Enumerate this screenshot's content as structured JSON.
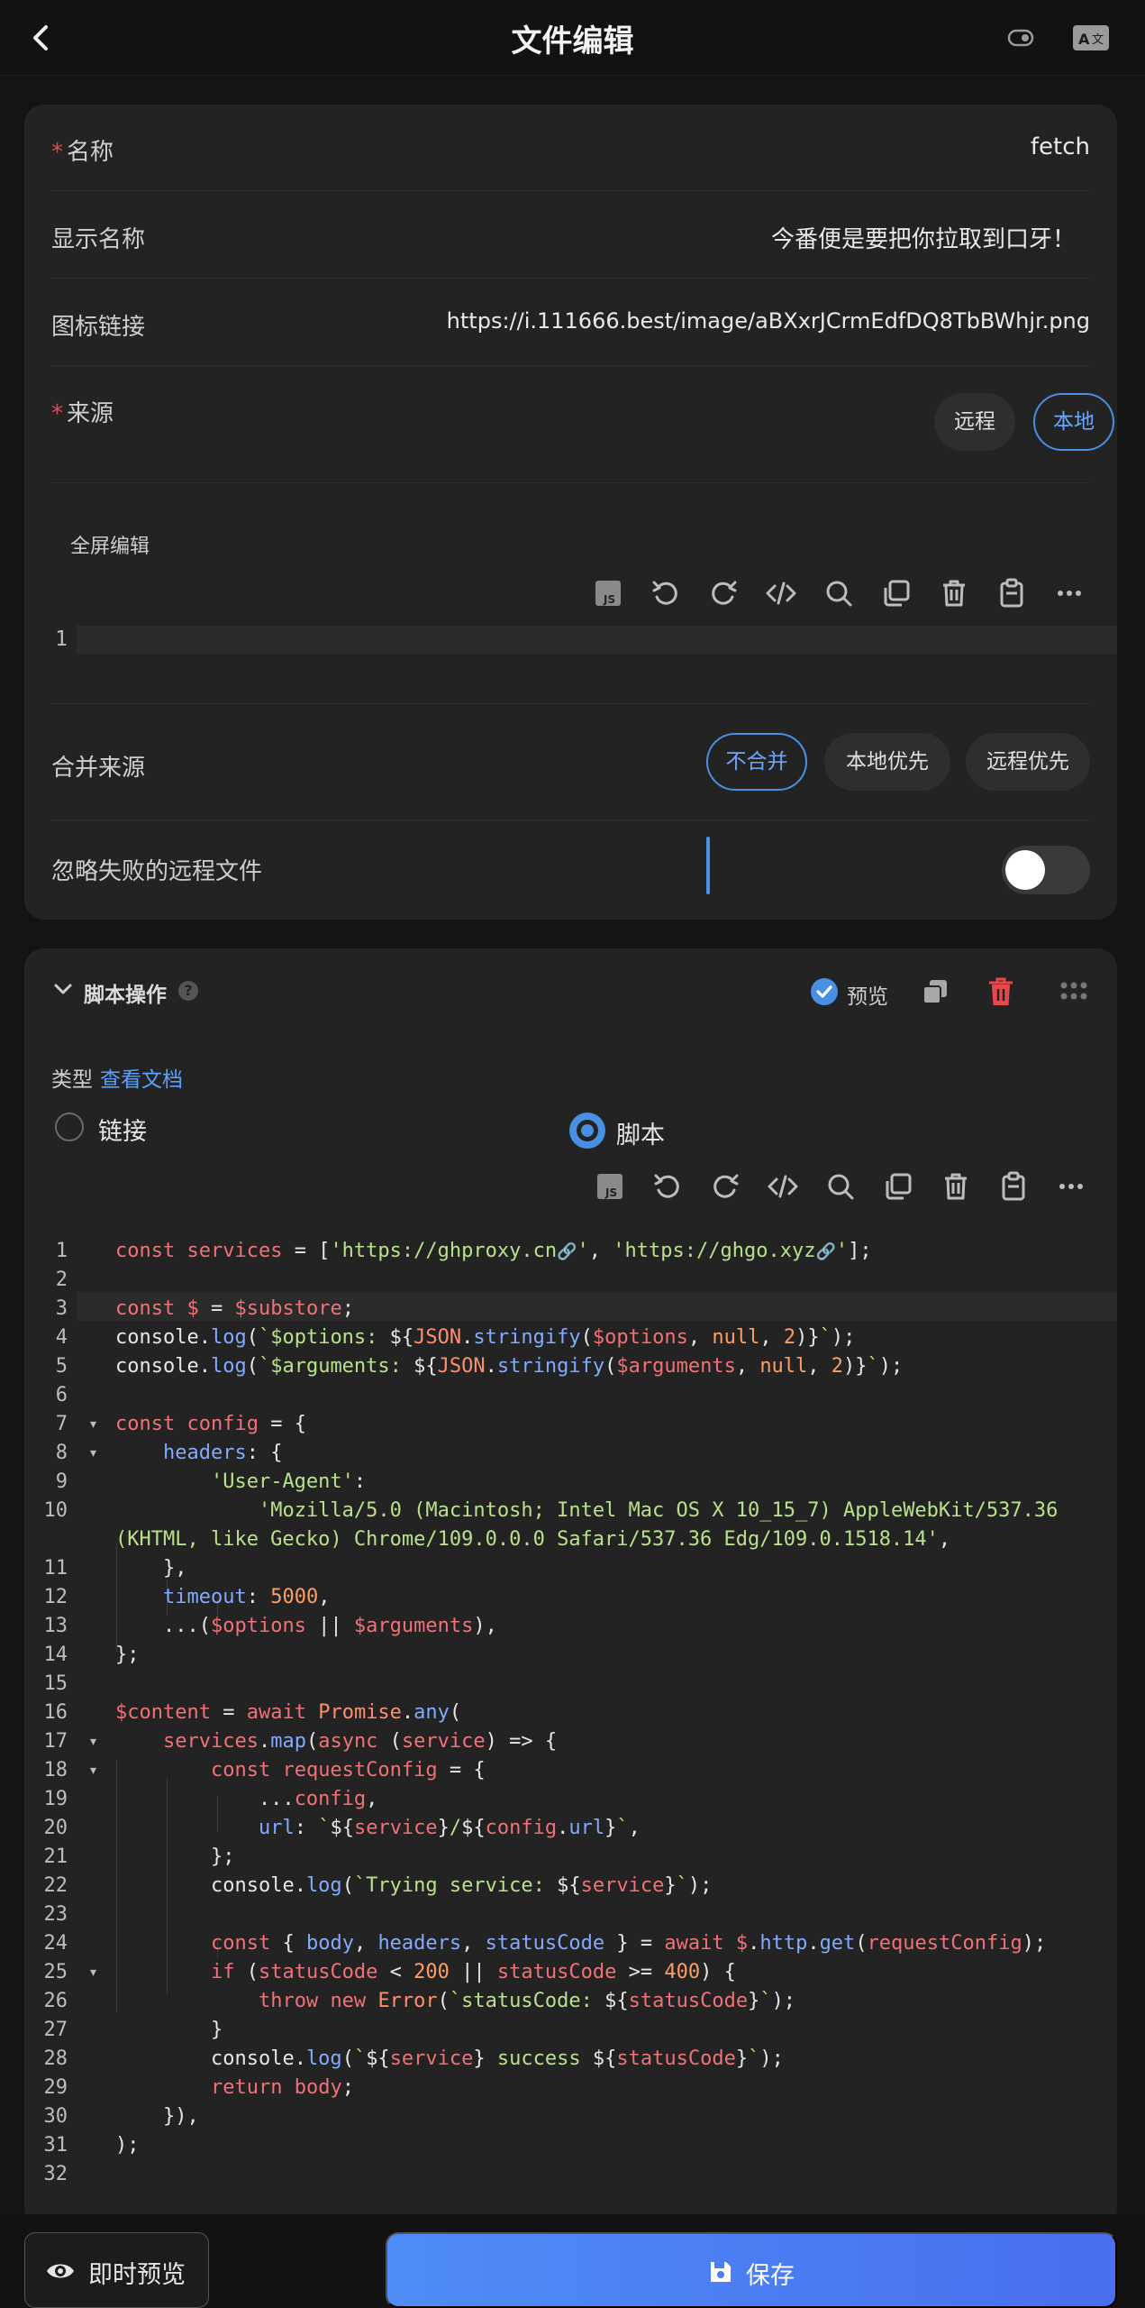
{
  "header": {
    "title": "文件编辑"
  },
  "form": {
    "name_label": "名称",
    "name_value": "fetch",
    "display_label": "显示名称",
    "display_value": "今番便是要把你拉取到口牙！",
    "icon_label": "图标链接",
    "icon_value": "https://i.111666.best/image/aBXxrJCrmEdfDQ8TbBWhjr.png",
    "source_label": "来源",
    "source_options": [
      "远程",
      "本地"
    ],
    "source_selected": "本地",
    "fullscreen_label": "全屏编辑",
    "editor_line": "1",
    "merge_label": "合并来源",
    "merge_options": [
      "不合并",
      "本地优先",
      "远程优先"
    ],
    "merge_selected": "不合并",
    "ignore_label": "忽略失败的远程文件",
    "ignore_enabled": false
  },
  "script": {
    "title": "脚本操作",
    "help": "?",
    "preview_label": "预览",
    "type_label": "类型",
    "docs_label": "查看文档",
    "option_link": "链接",
    "option_script": "脚本",
    "selected": "脚本"
  },
  "actions": {
    "preview": "即时预览",
    "save": "保存"
  },
  "colors": {
    "accent": "#4a90e2",
    "danger": "#e5484d",
    "card": "#232323",
    "background": "#141414"
  }
}
